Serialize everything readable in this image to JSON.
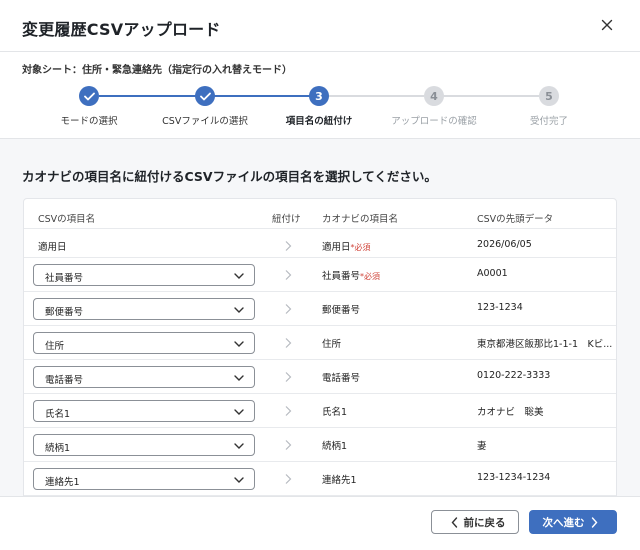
{
  "dialog": {
    "title": "変更履歴CSVアップロード",
    "subtitle": "対象シート：住所・緊急連絡先（指定行の入れ替えモード）"
  },
  "steps": [
    {
      "number": "1",
      "label": "モードの選択",
      "state": "done"
    },
    {
      "number": "2",
      "label": "CSVファイルの選択",
      "state": "done"
    },
    {
      "number": "3",
      "label": "項目名の紐付け",
      "state": "current"
    },
    {
      "number": "4",
      "label": "アップロードの確認",
      "state": "future"
    },
    {
      "number": "5",
      "label": "受付完了",
      "state": "future"
    }
  ],
  "instruction": "カオナビの項目名に紐付けるCSVファイルの項目名を選択してください。",
  "table": {
    "headers": {
      "csv_field": "CSVの項目名",
      "link": "紐付け",
      "kaonavi_field": "カオナビの項目名",
      "csv_first": "CSVの先頭データ"
    },
    "required_label": "*必須",
    "rows": [
      {
        "csv": "適用日",
        "kaonavi": "適用日",
        "required": true,
        "first": "2026/06/05",
        "type": "text"
      },
      {
        "csv": "社員番号",
        "kaonavi": "社員番号",
        "required": true,
        "first": "A0001",
        "type": "select"
      },
      {
        "csv": "郵便番号",
        "kaonavi": "郵便番号",
        "required": false,
        "first": "123-1234",
        "type": "select"
      },
      {
        "csv": "住所",
        "kaonavi": "住所",
        "required": false,
        "first": "東京都港区飯那比1-1-1　Kビ...",
        "type": "select"
      },
      {
        "csv": "電話番号",
        "kaonavi": "電話番号",
        "required": false,
        "first": "0120-222-3333",
        "type": "select"
      },
      {
        "csv": "氏名1",
        "kaonavi": "氏名1",
        "required": false,
        "first": "カオナビ　聡美",
        "type": "select"
      },
      {
        "csv": "続柄1",
        "kaonavi": "続柄1",
        "required": false,
        "first": "妻",
        "type": "select"
      },
      {
        "csv": "連絡先1",
        "kaonavi": "連絡先1",
        "required": false,
        "first": "123-1234-1234",
        "type": "select"
      }
    ]
  },
  "footer": {
    "back_label": "前に戻る",
    "next_label": "次へ進む"
  },
  "colors": {
    "accent": "#3e6fbf",
    "required": "#d0443a"
  }
}
